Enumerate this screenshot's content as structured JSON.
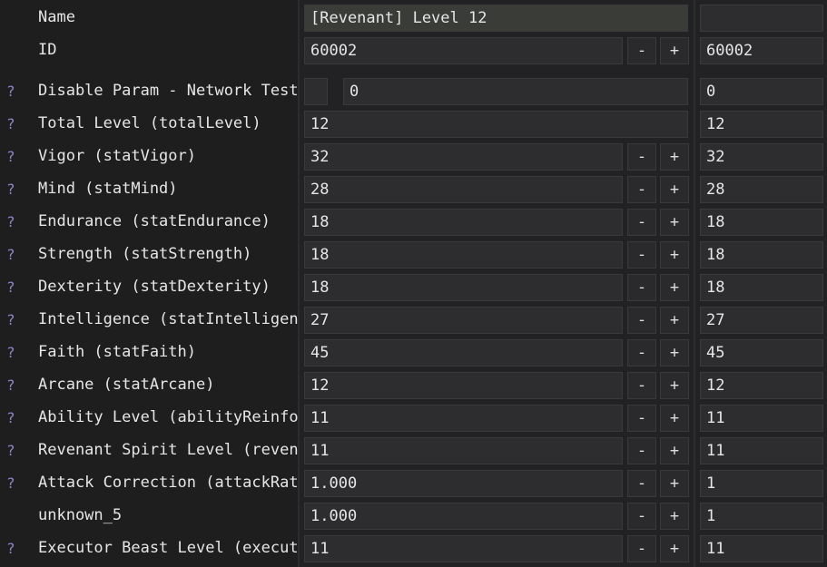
{
  "name_row": {
    "label": "Name",
    "value": "[Revenant] Level 12",
    "compare": ""
  },
  "id_row": {
    "label": "ID",
    "value": "60002",
    "compare": "60002"
  },
  "disable_row": {
    "label": "Disable Param - Network Test",
    "value": "0",
    "compare": "0",
    "help": "?"
  },
  "total_row": {
    "label": "Total Level (totalLevel)",
    "value": "12",
    "compare": "12",
    "help": "?"
  },
  "buttons": {
    "minus": "-",
    "plus": "+"
  },
  "fields": [
    {
      "help": "?",
      "label": "Vigor (statVigor)",
      "value": "32",
      "compare": "32"
    },
    {
      "help": "?",
      "label": "Mind (statMind)",
      "value": "28",
      "compare": "28"
    },
    {
      "help": "?",
      "label": "Endurance (statEndurance)",
      "value": "18",
      "compare": "18"
    },
    {
      "help": "?",
      "label": "Strength (statStrength)",
      "value": "18",
      "compare": "18"
    },
    {
      "help": "?",
      "label": "Dexterity (statDexterity)",
      "value": "18",
      "compare": "18"
    },
    {
      "help": "?",
      "label": "Intelligence (statIntelligence)",
      "value": "27",
      "compare": "27"
    },
    {
      "help": "?",
      "label": "Faith (statFaith)",
      "value": "45",
      "compare": "45"
    },
    {
      "help": "?",
      "label": "Arcane (statArcane)",
      "value": "12",
      "compare": "12"
    },
    {
      "help": "?",
      "label": "Ability Level (abilityReinforce)",
      "value": "11",
      "compare": "11"
    },
    {
      "help": "?",
      "label": "Revenant Spirit Level (revenant)",
      "value": "11",
      "compare": "11"
    },
    {
      "help": "?",
      "label": "Attack Correction (attackRate)",
      "value": "1.000",
      "compare": "1"
    },
    {
      "help": "",
      "label": "unknown_5",
      "value": "1.000",
      "compare": "1"
    },
    {
      "help": "?",
      "label": "Executor Beast Level (executor)",
      "value": "11",
      "compare": "11"
    }
  ]
}
